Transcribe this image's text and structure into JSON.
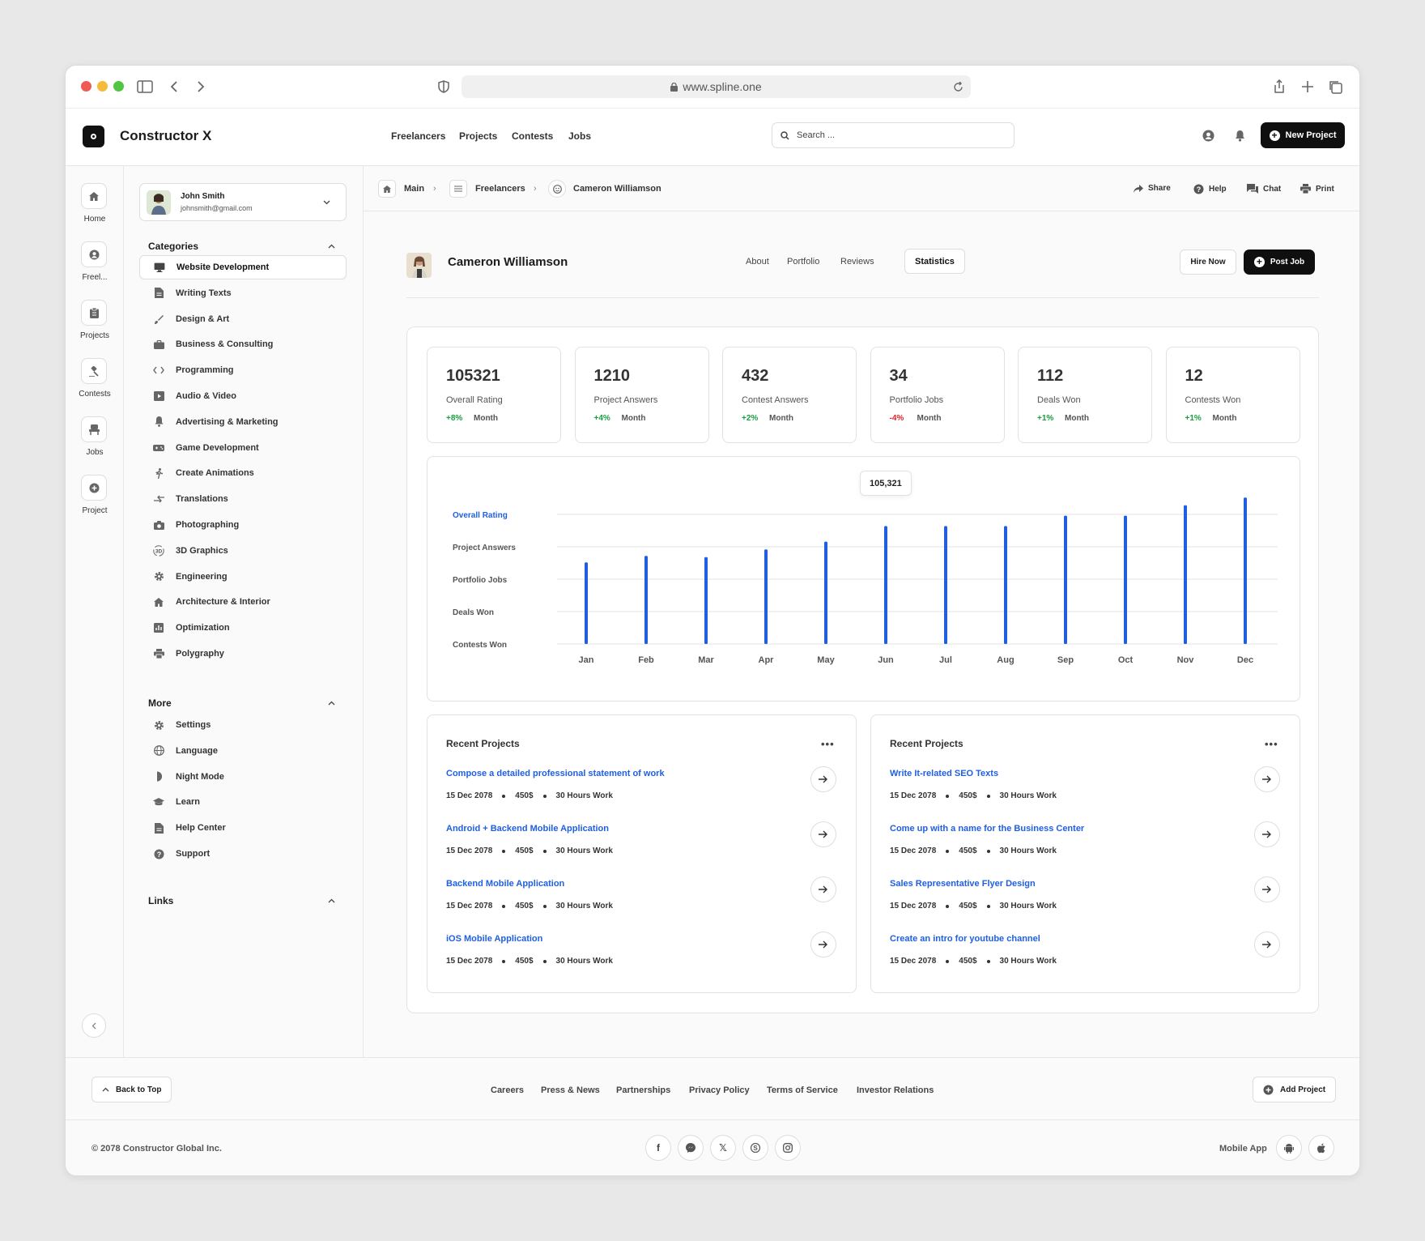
{
  "browser": {
    "url": "www.spline.one"
  },
  "app": {
    "brand": "Constructor X"
  },
  "topnav": [
    "Freelancers",
    "Projects",
    "Contests",
    "Jobs"
  ],
  "search": {
    "placeholder": "Search ..."
  },
  "new_project": "New Project",
  "rail": [
    {
      "label": "Home",
      "icon": "home-icon"
    },
    {
      "label": "Freel...",
      "icon": "user-icon"
    },
    {
      "label": "Projects",
      "icon": "clipboard-icon"
    },
    {
      "label": "Contests",
      "icon": "gavel-icon"
    },
    {
      "label": "Jobs",
      "icon": "chair-icon"
    },
    {
      "label": "Project",
      "icon": "plus-circle-icon"
    }
  ],
  "user": {
    "name": "John Smith",
    "email": "johnsmith@gmail.com"
  },
  "sidebar": {
    "categories_title": "Categories",
    "categories": [
      {
        "label": "Website Development",
        "icon": "monitor-icon"
      },
      {
        "label": "Writing Texts",
        "icon": "document-icon"
      },
      {
        "label": "Design & Art",
        "icon": "brush-icon"
      },
      {
        "label": "Business & Consulting",
        "icon": "briefcase-icon"
      },
      {
        "label": "Programming",
        "icon": "code-icon"
      },
      {
        "label": "Audio & Video",
        "icon": "play-icon"
      },
      {
        "label": "Advertising & Marketing",
        "icon": "bell-icon"
      },
      {
        "label": "Game Development",
        "icon": "gamepad-icon"
      },
      {
        "label": "Create Animations",
        "icon": "running-icon"
      },
      {
        "label": "Translations",
        "icon": "arrows-icon"
      },
      {
        "label": "Photographing",
        "icon": "camera-icon"
      },
      {
        "label": "3D Graphics",
        "icon": "3d-icon"
      },
      {
        "label": "Engineering",
        "icon": "gear-icon"
      },
      {
        "label": "Architecture & Interior",
        "icon": "house-icon"
      },
      {
        "label": "Optimization",
        "icon": "chart-icon"
      },
      {
        "label": "Polygraphy",
        "icon": "printer-icon"
      }
    ],
    "more_title": "More",
    "more": [
      {
        "label": "Settings",
        "icon": "gear-icon"
      },
      {
        "label": "Language",
        "icon": "globe-icon"
      },
      {
        "label": "Night Mode",
        "icon": "moon-icon"
      },
      {
        "label": "Learn",
        "icon": "graduation-icon"
      },
      {
        "label": "Help Center",
        "icon": "document-icon"
      },
      {
        "label": "Support",
        "icon": "question-icon"
      }
    ],
    "links_title": "Links"
  },
  "breadcrumb": [
    "Main",
    "Freelancers",
    "Cameron Williamson"
  ],
  "actions": [
    "Share",
    "Help",
    "Chat",
    "Print"
  ],
  "profile": {
    "name": "Cameron Williamson",
    "tabs": [
      "About",
      "Portfolio",
      "Reviews",
      "Statistics"
    ],
    "active_tab": "Statistics",
    "hire": "Hire Now",
    "post_job": "Post Job"
  },
  "stats": [
    {
      "value": "105321",
      "label": "Overall Rating",
      "change": "+8%",
      "period": "Month"
    },
    {
      "value": "1210",
      "label": "Project Answers",
      "change": "+4%",
      "period": "Month"
    },
    {
      "value": "432",
      "label": "Contest Answers",
      "change": "+2%",
      "period": "Month"
    },
    {
      "value": "34",
      "label": "Portfolio Jobs",
      "change": "-4%",
      "period": "Month"
    },
    {
      "value": "112",
      "label": "Deals Won",
      "change": "+1%",
      "period": "Month"
    },
    {
      "value": "12",
      "label": "Contests Won",
      "change": "+1%",
      "period": "Month"
    }
  ],
  "colors": {
    "positive": "#1a9e3f",
    "negative": "#e0242a",
    "accent": "#1f5fe0"
  },
  "chart_data": {
    "type": "bar",
    "categories": [
      "Jan",
      "Feb",
      "Mar",
      "Apr",
      "May",
      "Jun",
      "Jul",
      "Aug",
      "Sep",
      "Oct",
      "Nov",
      "Dec"
    ],
    "y_labels": [
      "Overall Rating",
      "Project Answers",
      "Portfolio Jobs",
      "Deals Won",
      "Contests Won"
    ],
    "active_label": "Overall Rating",
    "values": [
      0.63,
      0.68,
      0.67,
      0.73,
      0.79,
      0.91,
      0.91,
      0.91,
      0.99,
      0.99,
      1.07,
      1.13
    ],
    "tooltip": {
      "category": "Jun",
      "text": "105,321"
    },
    "grid": true
  },
  "recent_left": {
    "title": "Recent Projects",
    "items": [
      {
        "title": "Compose a detailed professional statement of work",
        "date": "15 Dec 2078",
        "price": "450$",
        "hours": "30 Hours Work"
      },
      {
        "title": "Android + Backend Mobile Application",
        "date": "15 Dec 2078",
        "price": "450$",
        "hours": "30 Hours Work"
      },
      {
        "title": "Backend Mobile Application",
        "date": "15 Dec 2078",
        "price": "450$",
        "hours": "30 Hours Work"
      },
      {
        "title": "iOS Mobile Application",
        "date": "15 Dec 2078",
        "price": "450$",
        "hours": "30 Hours Work"
      }
    ]
  },
  "recent_right": {
    "title": "Recent Projects",
    "items": [
      {
        "title": "Write It-related SEO Texts",
        "date": "15 Dec 2078",
        "price": "450$",
        "hours": "30 Hours Work"
      },
      {
        "title": "Come up with a name for the Business Center",
        "date": "15 Dec 2078",
        "price": "450$",
        "hours": "30 Hours Work"
      },
      {
        "title": "Sales Representative Flyer Design",
        "date": "15 Dec 2078",
        "price": "450$",
        "hours": "30 Hours Work"
      },
      {
        "title": "Create an intro for youtube channel",
        "date": "15 Dec 2078",
        "price": "450$",
        "hours": "30 Hours Work"
      }
    ]
  },
  "footer": {
    "back_to_top": "Back to Top",
    "links": [
      "Careers",
      "Press & News",
      "Partnerships",
      "Privacy Policy",
      "Terms of Service",
      "Investor Relations"
    ],
    "add_project": "Add Project",
    "copyright": "© 2078 Constructor Global Inc.",
    "socials": [
      "facebook-icon",
      "messenger-icon",
      "x-icon",
      "skype-icon",
      "instagram-icon"
    ],
    "mobile_app": "Mobile App"
  }
}
